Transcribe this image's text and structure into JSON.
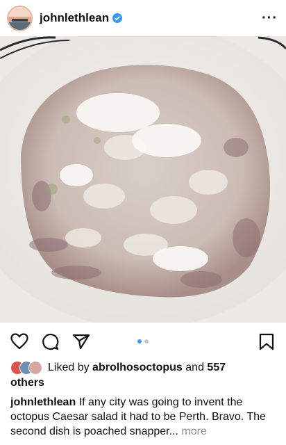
{
  "post": {
    "username": "johnlethlean",
    "verified": true,
    "more_icon": "ellipsis-icon"
  },
  "carousel": {
    "current": 1,
    "total": 2,
    "active_color": "#3897f0",
    "inactive_color": "#c7c7c7"
  },
  "actions": {
    "like_icon": "heart-icon",
    "comment_icon": "comment-icon",
    "share_icon": "paper-plane-icon",
    "save_icon": "bookmark-icon"
  },
  "likes": {
    "prefix": "Liked by ",
    "first_user": "abrolhosoctopus",
    "middle": " and ",
    "count": "557",
    "suffix": "others"
  },
  "caption": {
    "username": "johnlethlean",
    "text": "If any city was going to invent the octopus Caesar salad it had to be Perth. Bravo. The second dish is poached snapper...",
    "more_label": "more"
  },
  "colors": {
    "accent": "#3897f0",
    "text": "#111111",
    "muted": "#8e8e8e"
  }
}
